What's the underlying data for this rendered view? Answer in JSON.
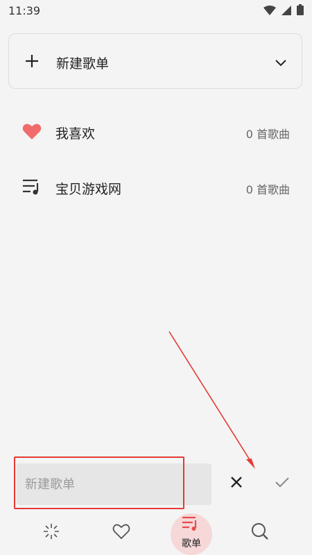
{
  "status_bar": {
    "time": "11:39",
    "icons": [
      "wifi-icon",
      "signal-icon",
      "battery-icon"
    ]
  },
  "new_playlist_card": {
    "label": "新建歌单",
    "icons": [
      "plus-icon",
      "chevron-down-icon"
    ]
  },
  "playlists": [
    {
      "title": "我喜欢",
      "count": "0 首歌曲",
      "icon": "heart-icon",
      "icon_color": "#f26b6b"
    },
    {
      "title": "宝贝游戏网",
      "count": "0 首歌曲",
      "icon": "playlist-icon"
    }
  ],
  "input": {
    "placeholder": "新建歌单",
    "value": ""
  },
  "actions": {
    "cancel_icon": "close-icon",
    "confirm_icon": "check-icon"
  },
  "bottom_nav": {
    "items": [
      {
        "icon": "spark-icon",
        "label": ""
      },
      {
        "icon": "heart-outline-icon",
        "label": ""
      },
      {
        "icon": "playlist-icon",
        "label": "歌单",
        "active": true
      },
      {
        "icon": "search-icon",
        "label": ""
      }
    ],
    "active_color": "#e84b4b",
    "active_bg": "#f6d8d8"
  },
  "annotation": {
    "highlight_color": "#e53935"
  }
}
